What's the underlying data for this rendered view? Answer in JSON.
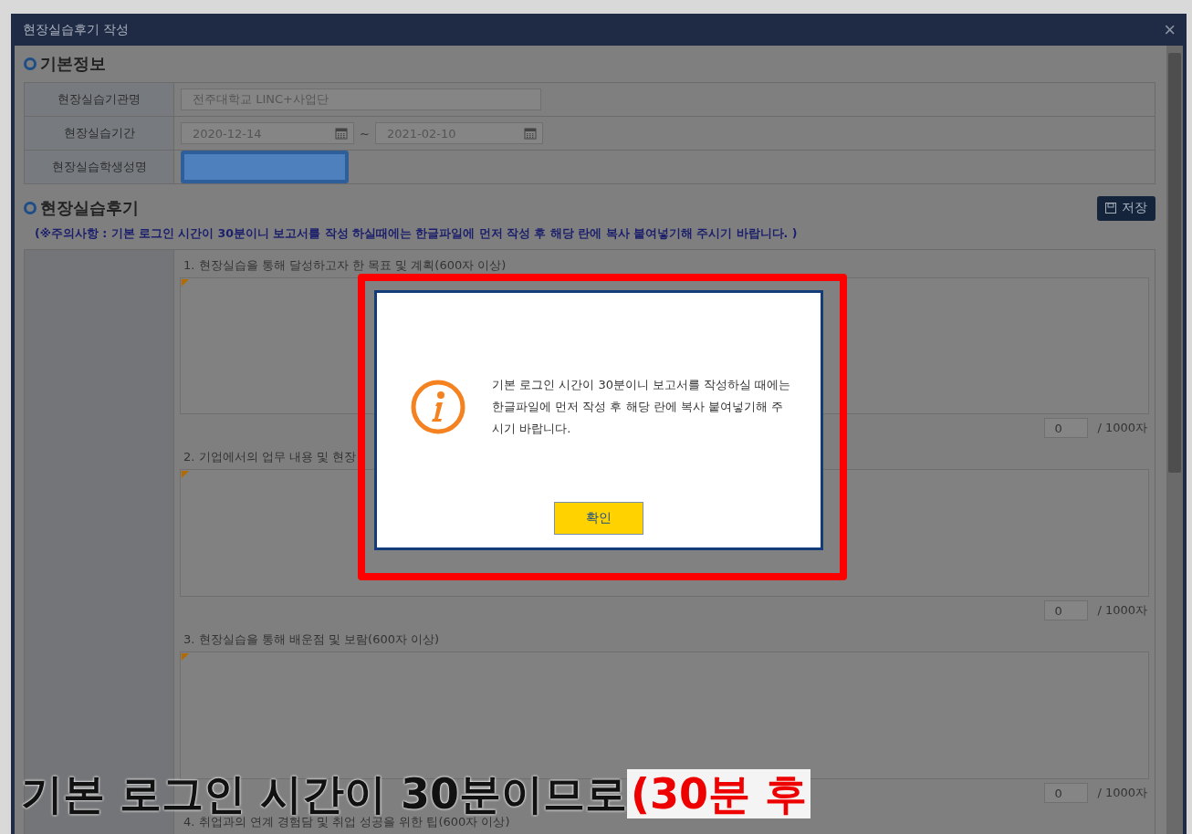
{
  "window": {
    "title": "현장실습후기 작성",
    "close": "×"
  },
  "basic_info": {
    "heading": "기본정보",
    "rows": [
      {
        "label": "현장실습기관명",
        "kind": "text",
        "value": "전주대학교 LINC+사업단"
      },
      {
        "label": "현장실습기간",
        "kind": "period",
        "start": "2020-12-14",
        "separator": "~",
        "end": "2021-02-10"
      },
      {
        "label": "현장실습학생성명",
        "kind": "redacted"
      }
    ]
  },
  "review": {
    "heading": "현장실습후기",
    "save_button": "저장",
    "notice": "(※주의사항 : 기본 로그인 시간이 30분이니 보고서를 작성 하실때에는 한글파일에 먼저 작성 후 해당 란에 복사 붙여넣기해 주시기 바랍니다. )",
    "questions": [
      {
        "label": "1. 현장실습을 통해 달성하고자 한 목표 및 계획(600자 이상)",
        "count": "0",
        "limit": "/ 1000자"
      },
      {
        "label": "2. 기업에서의 업무 내용 및 현장",
        "count": "0",
        "limit": "/ 1000자"
      },
      {
        "label": "3. 현장실습을 통해 배운점 및 보람(600자 이상)",
        "count": "0",
        "limit": "/ 1000자"
      },
      {
        "label": "4. 취업과의 연계 경험담 및 취업 성공을 위한 팁(600자 이상)"
      }
    ]
  },
  "dialog": {
    "message": "기본 로그인 시간이 30분이니 보고서를 작성하실 때에는 한글파일에 먼저 작성 후 해당 란에 복사 붙여넣기해 주시기 바랍니다.",
    "confirm": "확인",
    "highlighted": true
  },
  "caption": {
    "text": "기본 로그인 시간이 30분이므로",
    "highlight": "(30분 후"
  }
}
